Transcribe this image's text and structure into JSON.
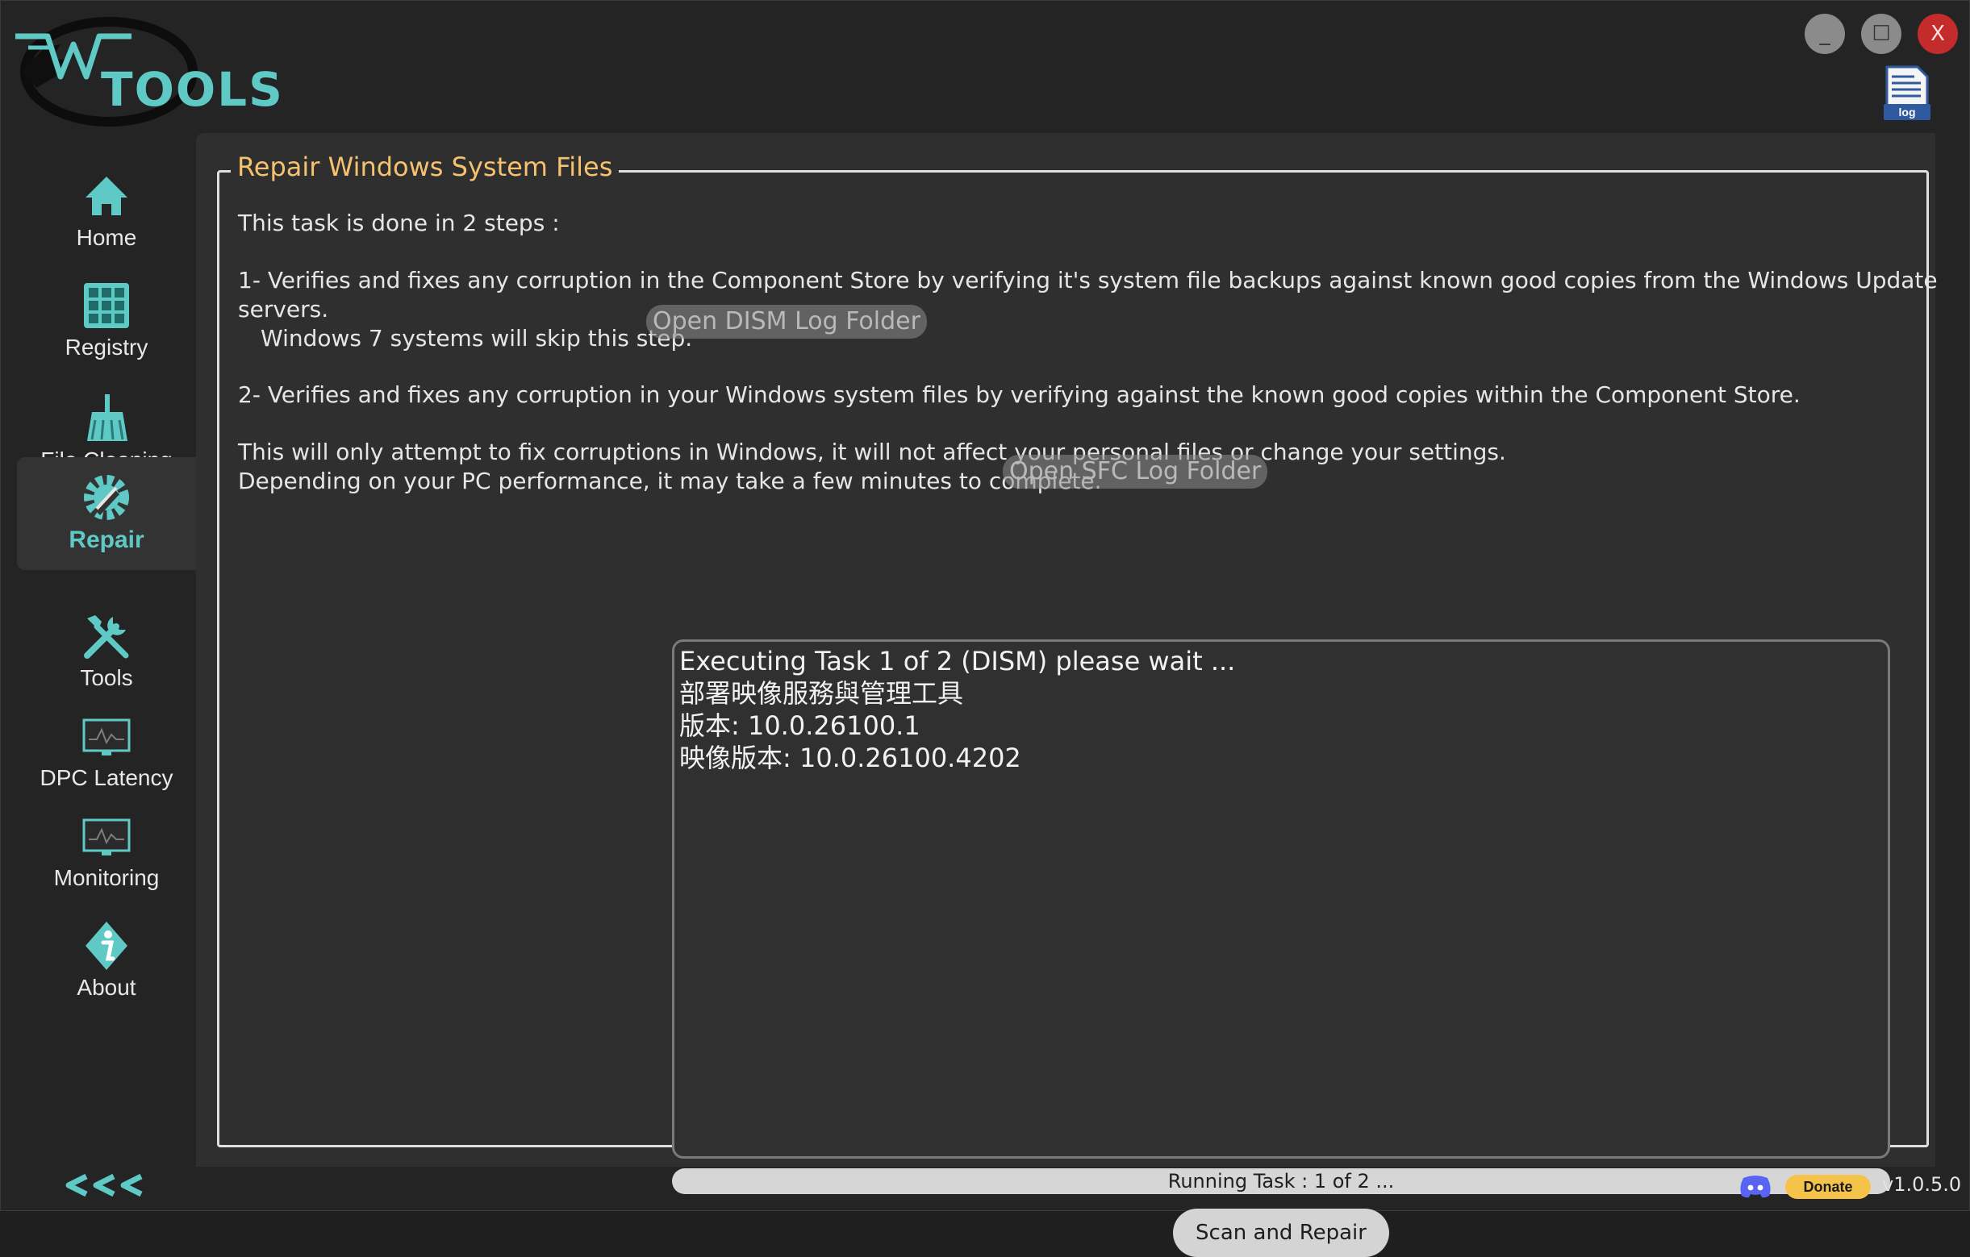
{
  "app": {
    "logo_text": "TOOLS",
    "accent_color": "#5fc9c5",
    "title_color": "#f6c26f"
  },
  "window_controls": {
    "minimize": "_",
    "maximize": "☐",
    "close": "X"
  },
  "log_button": {
    "label": "log"
  },
  "sidebar": {
    "items": [
      {
        "label": "Home",
        "icon": "home-icon"
      },
      {
        "label": "Registry",
        "icon": "registry-icon"
      },
      {
        "label": "File Cleaning",
        "icon": "broom-icon"
      },
      {
        "label": "Repair",
        "icon": "gear-icon",
        "active": true
      },
      {
        "label": "Tools",
        "icon": "tools-icon"
      },
      {
        "label": "DPC Latency",
        "icon": "monitor-icon"
      },
      {
        "label": "Monitoring",
        "icon": "monitor-icon"
      },
      {
        "label": "About",
        "icon": "info-icon"
      }
    ],
    "collapse_icon": "collapse-arrows-icon"
  },
  "repair": {
    "title": "Repair Windows System Files",
    "intro": "This task is done in 2 steps :",
    "step1_line1": "1- Verifies and fixes any corruption in the Component Store by verifying it's system file backups against known good copies from the Windows Update",
    "step1_line2": "servers.",
    "step1_line3": "Windows 7 systems will skip this step.",
    "step2": "2- Verifies and fixes any corruption in your Windows system files by verifying against the known good copies within the Component Store.",
    "note_line1": "This will only attempt to fix corruptions in Windows, it will not affect your personal files or change your settings.",
    "note_line2": "Depending on your PC performance, it may take a few minutes to complete.",
    "open_dism_log": "Open DISM Log Folder",
    "open_sfc_log": "Open SFC Log Folder",
    "console_lines": [
      "Executing Task 1 of 2 (DISM) please wait ...",
      "部署映像服務與管理工具",
      "版本: 10.0.26100.1",
      "映像版本: 10.0.26100.4202"
    ],
    "progress_text": "Running Task : 1 of 2 ...",
    "progress_fraction": 0,
    "scan_button": "Scan and Repair"
  },
  "footer": {
    "discord_icon": "discord-icon",
    "donate_label": "Donate",
    "version": "v1.0.5.0"
  }
}
